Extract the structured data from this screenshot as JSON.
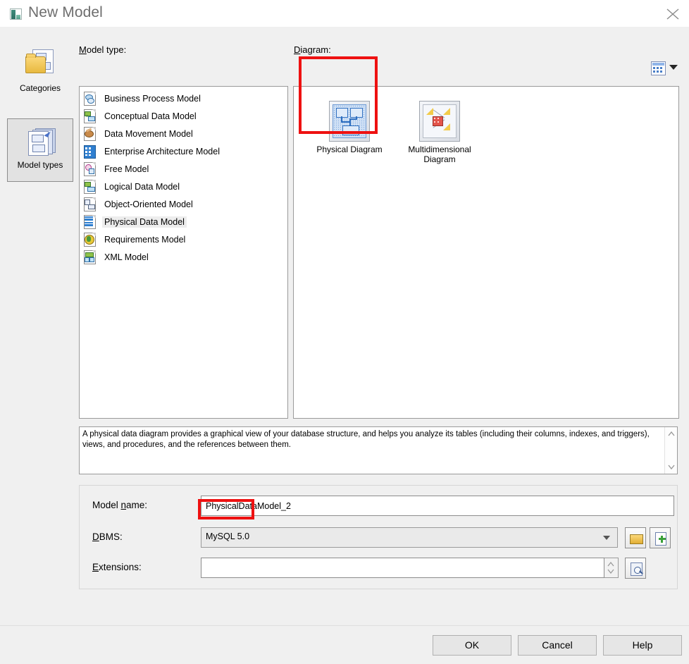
{
  "window": {
    "title": "New Model",
    "title_icon": "model-icon",
    "close_icon": "close-icon"
  },
  "sidebar": {
    "items": [
      {
        "label": "Categories",
        "icon": "folder-pages-icon",
        "selected": false
      },
      {
        "label": "Model types",
        "icon": "stacked-pages-icon",
        "selected": true
      }
    ]
  },
  "model_type": {
    "label": "Model type:",
    "accel": "M",
    "items": [
      {
        "label": "Business Process Model",
        "icon": "business-process-icon",
        "selected": false
      },
      {
        "label": "Conceptual Data Model",
        "icon": "conceptual-data-icon",
        "selected": false
      },
      {
        "label": "Data Movement Model",
        "icon": "data-movement-icon",
        "selected": false
      },
      {
        "label": "Enterprise Architecture Model",
        "icon": "enterprise-architecture-icon",
        "selected": false
      },
      {
        "label": "Free Model",
        "icon": "free-model-icon",
        "selected": false
      },
      {
        "label": "Logical Data Model",
        "icon": "logical-data-icon",
        "selected": false
      },
      {
        "label": "Object-Oriented Model",
        "icon": "object-oriented-icon",
        "selected": false
      },
      {
        "label": "Physical Data Model",
        "icon": "physical-data-icon",
        "selected": true
      },
      {
        "label": "Requirements Model",
        "icon": "requirements-icon",
        "selected": false
      },
      {
        "label": "XML Model",
        "icon": "xml-model-icon",
        "selected": false
      }
    ]
  },
  "diagram": {
    "label": "Diagram:",
    "accel": "D",
    "items": [
      {
        "label": "Physical Diagram",
        "icon": "physical-diagram-icon",
        "selected": true,
        "annotated": true
      },
      {
        "label": "Multidimensional Diagram",
        "icon": "multidimensional-diagram-icon",
        "selected": false,
        "annotated": false
      }
    ],
    "view_toggle_icon": "list-view-icon"
  },
  "description": {
    "text": "A physical data diagram provides a graphical view of your database structure, and helps you analyze its tables (including their columns, indexes, and triggers), views, and procedures, and the references between them."
  },
  "form": {
    "model_name": {
      "label": "Model name:",
      "accel": "n",
      "value": "PhysicalDataModel_2",
      "placeholder": ""
    },
    "dbms": {
      "label": "DBMS:",
      "accel": "D",
      "value": "MySQL 5.0",
      "annotated": true,
      "browse_icon": "folder-icon",
      "new_icon": "new-file-icon"
    },
    "extensions": {
      "label": "Extensions:",
      "accel": "E",
      "value": "",
      "placeholder": "",
      "preview_icon": "preview-icon"
    }
  },
  "footer": {
    "buttons": [
      {
        "label": "OK",
        "name": "ok-button"
      },
      {
        "label": "Cancel",
        "name": "cancel-button"
      },
      {
        "label": "Help",
        "name": "help-button"
      }
    ]
  },
  "colors": {
    "annotation": "#ee1111",
    "dialog_bg": "#f0f0f0",
    "selection": "#ededed"
  }
}
